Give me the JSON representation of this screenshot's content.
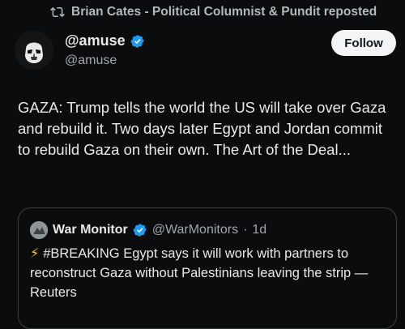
{
  "repost": {
    "text": "Brian Cates - Political Columnist & Pundit reposted",
    "icon": "repost-icon"
  },
  "author": {
    "display_name": "@amuse",
    "handle": "@amuse",
    "verified": true,
    "avatar_icon": "stormtrooper-avatar"
  },
  "follow_button": {
    "label": "Follow"
  },
  "tweet": {
    "text": "GAZA: Trump tells the world the US will take over Gaza and rebuild it. Two days later Egypt and Jordan commit to rebuild Gaza on their own. The Art of the Deal..."
  },
  "quote": {
    "name": "War Monitor",
    "verified": true,
    "handle": "@WarMonitors",
    "separator": "·",
    "time": "1d",
    "emoji": "⚡",
    "text": "#BREAKING Egypt says it will work with partners to reconstruct Gaza without Palestinians leaving the strip — Reuters"
  },
  "colors": {
    "background": "#0b0c0e",
    "text": "#e7e9ea",
    "muted": "#a2a6ab",
    "verified_blue": "#1d9bf0",
    "follow_bg": "#f3f4f5"
  }
}
